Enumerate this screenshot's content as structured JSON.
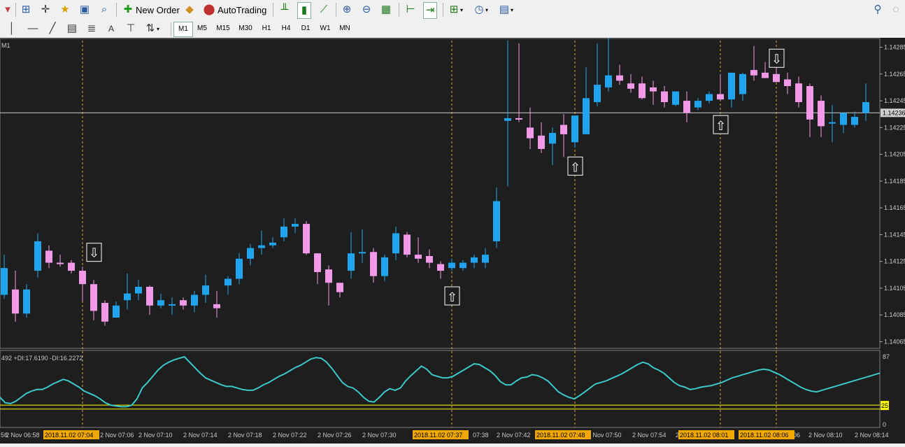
{
  "toolbar": {
    "new_order_label": "New Order",
    "autotrading_label": "AutoTrading",
    "icons": [
      "new-chart-icon",
      "profiles-icon",
      "crosshair-icon",
      "favorites-icon",
      "navigator-icon",
      "strategy-tester-icon",
      "new-order-icon",
      "metaeditor-icon",
      "autotrading-icon",
      "bar-chart-icon",
      "candlestick-icon",
      "line-chart-icon",
      "zoom-in-icon",
      "zoom-out-icon",
      "tile-windows-icon",
      "chart-shift-icon",
      "autoscroll-icon",
      "indicators-icon",
      "periods-icon",
      "templates-icon",
      "search-icon",
      "chat-icon"
    ]
  },
  "drawing_toolbar": {
    "icons": [
      "vertical-line-icon",
      "horizontal-line-icon",
      "trendline-icon",
      "fibonacci-icon",
      "equidistant-channel-icon",
      "text-icon",
      "text-label-icon",
      "arrows-icon"
    ],
    "text_tool_label": "A",
    "timeframes": [
      "M1",
      "M5",
      "M15",
      "M30",
      "H1",
      "H4",
      "D1",
      "W1",
      "MN"
    ],
    "active_timeframe": "M1"
  },
  "chart": {
    "symbol_label": "M1",
    "current_price": "1.14236",
    "bull_color": "#1ea5ee",
    "bear_color": "#f29ae8",
    "background": "#1e1e1e",
    "price_ticks": [
      "1.14285",
      "1.14265",
      "1.14245",
      "1.14225",
      "1.14205",
      "1.14185",
      "1.14165",
      "1.14145",
      "1.14125",
      "1.14105",
      "1.14085",
      "1.14065"
    ],
    "time_labels": [
      "56",
      "2 Nov 06:58",
      "2 Nov 07:06",
      "2 Nov 07:10",
      "2 Nov 07:14",
      "2 Nov 07:18",
      "2 Nov 07:22",
      "2 Nov 07:26",
      "2 Nov 07:30",
      "07:38",
      "2 Nov 07:42",
      "2 Nov 07:50",
      "2 Nov 07:54",
      "2",
      "06",
      "2 Nov 08:10",
      "2 Nov 08:14"
    ],
    "highlight_time_labels": [
      "2018.11.02 07:04",
      "2018.11.02 07:37",
      "2018.11.02 07:48",
      "2018.11.02 08:01",
      "2018.11.02 08:06"
    ]
  },
  "indicator": {
    "label": "492 +DI:17.6190 -DI:16.2272",
    "scale_labels": [
      "87",
      "0"
    ],
    "level_label": "25",
    "colors": {
      "adx": "#3cc8c8",
      "plus_di": "#d0e020",
      "minus_di": "#e02020",
      "level": "#ffff00"
    }
  },
  "chart_data": {
    "type": "candlestick",
    "x": [
      "06:57",
      "06:58",
      "06:59",
      "07:00",
      "07:01",
      "07:02",
      "07:03",
      "07:04",
      "07:05",
      "07:06",
      "07:07",
      "07:08",
      "07:09",
      "07:10",
      "07:11",
      "07:12",
      "07:13",
      "07:14",
      "07:15",
      "07:16",
      "07:17",
      "07:18",
      "07:19",
      "07:20",
      "07:21",
      "07:22",
      "07:23",
      "07:24",
      "07:25",
      "07:26",
      "07:27",
      "07:28",
      "07:29",
      "07:30",
      "07:31",
      "07:32",
      "07:33",
      "07:34",
      "07:35",
      "07:36",
      "07:37",
      "07:38",
      "07:39",
      "07:40",
      "07:41",
      "07:42",
      "07:43",
      "07:44",
      "07:45",
      "07:46",
      "07:47",
      "07:48",
      "07:49",
      "07:50",
      "07:51",
      "07:52",
      "07:53",
      "07:54",
      "07:55",
      "07:56",
      "07:57",
      "07:58",
      "07:59",
      "08:00",
      "08:01",
      "08:02",
      "08:03",
      "08:04",
      "08:05",
      "08:06",
      "08:07",
      "08:08",
      "08:09",
      "08:10",
      "08:11",
      "08:12",
      "08:13",
      "08:14"
    ],
    "open": [
      1.141,
      1.14104,
      1.14086,
      1.14118,
      1.14133,
      1.14124,
      1.14124,
      1.14118,
      1.14108,
      1.14094,
      1.14083,
      1.14096,
      1.14101,
      1.14106,
      1.14092,
      1.14092,
      1.14096,
      1.14092,
      1.141,
      1.14093,
      1.14107,
      1.14112,
      1.14127,
      1.14135,
      1.14137,
      1.14143,
      1.14151,
      1.14153,
      1.14131,
      1.14119,
      1.14109,
      1.14118,
      1.14131,
      1.14132,
      1.14114,
      1.14131,
      1.14145,
      1.1413,
      1.14129,
      1.14123,
      1.1412,
      1.1412,
      1.14124,
      1.14124,
      1.1414,
      1.1423,
      1.14232,
      1.14225,
      1.14219,
      1.14213,
      1.14227,
      1.14214,
      1.1422,
      1.14244,
      1.14255,
      1.14264,
      1.14258,
      1.14258,
      1.14255,
      1.14252,
      1.14242,
      1.14245,
      1.1424,
      1.14245,
      1.1425,
      1.14246,
      1.1425,
      1.14268,
      1.14266,
      1.14265,
      1.14261,
      1.14258,
      1.14256,
      1.14245,
      1.14229,
      1.14227,
      1.14227,
      1.14236
    ],
    "close": [
      1.1412,
      1.14086,
      1.14104,
      1.1414,
      1.14124,
      1.14123,
      1.14118,
      1.14108,
      1.14088,
      1.1408,
      1.14092,
      1.14101,
      1.14106,
      1.14092,
      1.14096,
      1.14093,
      1.14092,
      1.141,
      1.14107,
      1.1409,
      1.14112,
      1.14127,
      1.14135,
      1.14137,
      1.14139,
      1.14151,
      1.14153,
      1.14131,
      1.14117,
      1.14109,
      1.14102,
      1.14131,
      1.14132,
      1.14114,
      1.14128,
      1.14146,
      1.1413,
      1.14127,
      1.14124,
      1.14118,
      1.14124,
      1.14124,
      1.14128,
      1.1413,
      1.1417,
      1.14232,
      1.14231,
      1.14217,
      1.14209,
      1.14221,
      1.1422,
      1.14234,
      1.14247,
      1.14257,
      1.14264,
      1.1426,
      1.14254,
      1.14247,
      1.14252,
      1.14244,
      1.14252,
      1.14236,
      1.14245,
      1.1425,
      1.14246,
      1.14266,
      1.14265,
      1.14264,
      1.14262,
      1.14259,
      1.14256,
      1.14244,
      1.14231,
      1.14226,
      1.14229,
      1.14236,
      1.14233,
      1.14244
    ],
    "high": [
      1.1413,
      1.14118,
      1.14108,
      1.14146,
      1.14137,
      1.1413,
      1.14126,
      1.14121,
      1.14111,
      1.14096,
      1.14095,
      1.14116,
      1.14111,
      1.14107,
      1.14101,
      1.14098,
      1.14098,
      1.14103,
      1.14115,
      1.14103,
      1.14114,
      1.14131,
      1.14138,
      1.14148,
      1.14143,
      1.14157,
      1.14157,
      1.14155,
      1.14131,
      1.14122,
      1.14109,
      1.14147,
      1.14149,
      1.14135,
      1.1413,
      1.14151,
      1.14147,
      1.14143,
      1.14134,
      1.14125,
      1.14127,
      1.14126,
      1.1413,
      1.14135,
      1.1418,
      1.1429,
      1.14288,
      1.1424,
      1.14229,
      1.14225,
      1.14235,
      1.14232,
      1.1427,
      1.14288,
      1.14293,
      1.14272,
      1.14265,
      1.14263,
      1.1426,
      1.14256,
      1.14252,
      1.14252,
      1.14247,
      1.14252,
      1.14265,
      1.14259,
      1.14266,
      1.14286,
      1.14274,
      1.1427,
      1.14266,
      1.14263,
      1.14258,
      1.14249,
      1.14242,
      1.14235,
      1.14237,
      1.14258
    ],
    "low": [
      1.14097,
      1.1408,
      1.14083,
      1.14113,
      1.1412,
      1.14121,
      1.14116,
      1.14095,
      1.14081,
      1.14077,
      1.14083,
      1.14089,
      1.14096,
      1.14085,
      1.1409,
      1.14085,
      1.14089,
      1.14087,
      1.14094,
      1.14083,
      1.141,
      1.14108,
      1.14122,
      1.1413,
      1.14135,
      1.1414,
      1.14146,
      1.1413,
      1.14108,
      1.14092,
      1.14098,
      1.14112,
      1.14124,
      1.14109,
      1.1411,
      1.14126,
      1.14128,
      1.14124,
      1.1412,
      1.14112,
      1.14118,
      1.14118,
      1.1412,
      1.1412,
      1.14135,
      1.14181,
      1.14229,
      1.14209,
      1.14206,
      1.14197,
      1.14203,
      1.1421,
      1.1422,
      1.14241,
      1.14252,
      1.14257,
      1.14251,
      1.14246,
      1.14242,
      1.1424,
      1.14241,
      1.14229,
      1.14238,
      1.14243,
      1.14245,
      1.1424,
      1.14245,
      1.1426,
      1.14262,
      1.1426,
      1.1425,
      1.1424,
      1.14218,
      1.14218,
      1.14214,
      1.14221,
      1.14225,
      1.1423
    ],
    "ylim": [
      1.1406,
      1.1429
    ],
    "vertical_line_times": [
      "07:04",
      "07:37",
      "07:48",
      "08:01",
      "08:06"
    ],
    "arrows": [
      {
        "time": "07:05",
        "price": 1.14125,
        "direction": "down"
      },
      {
        "time": "07:37",
        "price": 1.14106,
        "direction": "up"
      },
      {
        "time": "07:48",
        "price": 1.14203,
        "direction": "up"
      },
      {
        "time": "08:01",
        "price": 1.14234,
        "direction": "up"
      },
      {
        "time": "08:06",
        "price": 1.1427,
        "direction": "down"
      }
    ],
    "adx_series": [
      {
        "name": "ADX",
        "values": [
          35,
          28,
          27,
          30,
          35,
          40,
          43,
          45,
          45,
          48,
          52,
          55,
          58,
          56,
          52,
          48,
          43,
          40,
          37,
          33,
          28,
          25,
          24,
          23,
          23,
          25,
          33,
          47,
          54,
          62,
          70,
          76,
          80,
          83,
          85,
          87,
          80,
          73,
          66,
          60,
          57,
          54,
          51,
          49,
          49,
          47,
          45,
          44,
          44,
          47,
          51,
          54,
          58,
          62,
          65,
          69,
          73,
          76,
          80,
          84,
          86,
          85,
          80,
          72,
          63,
          54,
          49,
          47,
          42,
          35,
          30,
          29,
          35,
          42,
          46,
          44,
          47,
          56,
          63,
          69,
          75,
          71,
          64,
          62,
          60,
          60,
          62,
          66,
          70,
          74,
          78,
          77,
          73,
          69,
          63,
          55,
          51,
          51,
          56,
          60,
          61,
          64,
          63,
          60,
          56,
          49,
          42,
          38,
          35,
          33,
          37,
          42,
          47,
          52,
          54,
          56,
          59,
          62,
          65,
          69,
          73,
          77,
          80,
          78,
          73,
          70,
          66,
          60,
          54,
          50,
          48,
          45,
          46,
          48,
          49,
          50,
          52,
          54,
          57,
          60,
          62,
          64,
          66,
          68,
          70,
          71,
          70,
          67,
          64,
          60,
          56,
          52,
          48,
          45,
          43,
          42,
          44,
          46,
          48,
          50,
          52,
          54,
          56,
          58,
          60,
          62,
          64,
          66
        ]
      }
    ]
  }
}
